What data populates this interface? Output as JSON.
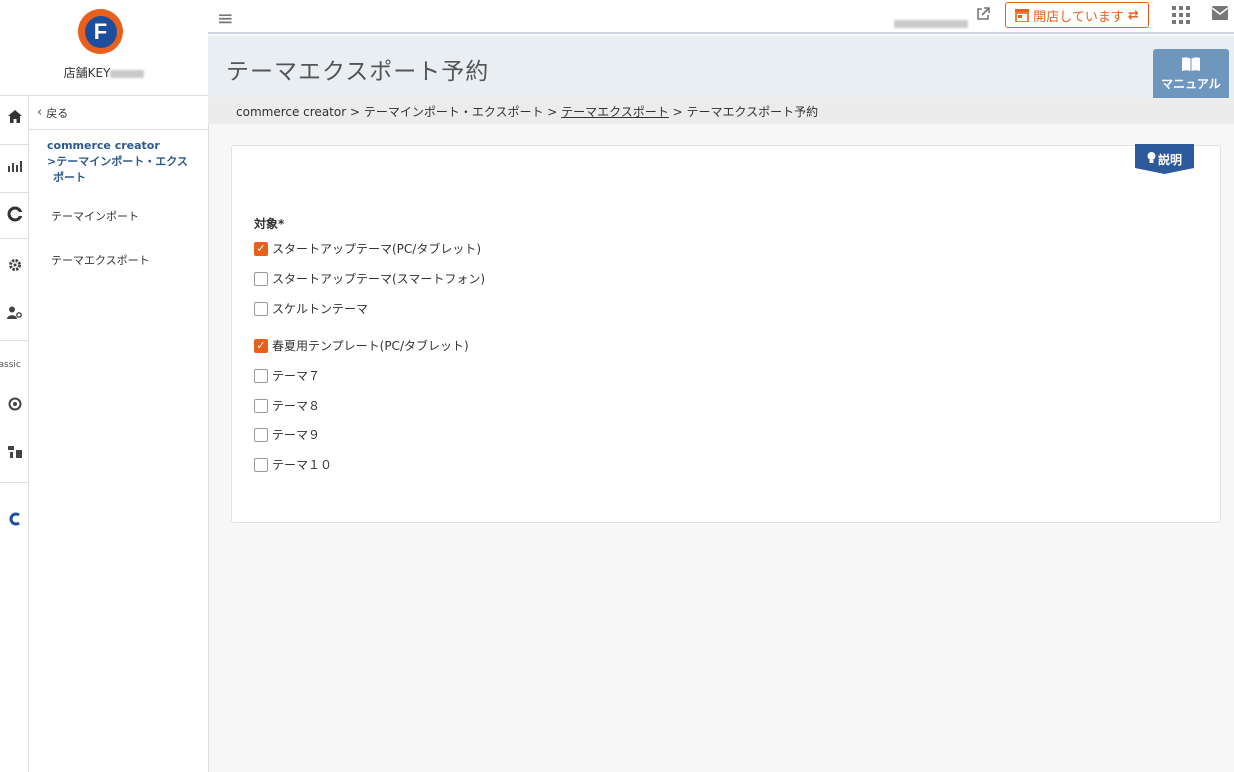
{
  "brand": {
    "logo_letter": "F",
    "shop_name": "店舗KEY"
  },
  "rail": {
    "classic_label": "lassic"
  },
  "subnav": {
    "back_label": "戻る",
    "section_title_line1": "commerce creator",
    "section_title_line2": ">テーマインポート・エクス",
    "section_title_line3": "ポート",
    "items": [
      {
        "label": "テーマインポート"
      },
      {
        "label": "テーマエクスポート"
      }
    ]
  },
  "topbar": {
    "store_status": "開店しています"
  },
  "header": {
    "title": "テーマエクスポート予約",
    "manual_label": "マニュアル"
  },
  "breadcrumb": {
    "part1": "commerce creator > テーマインポート・エクスポート > ",
    "link": "テーマエクスポート",
    "part2": " > テーマエクスポート予約"
  },
  "form": {
    "explain_label": "説明",
    "field_label": "対象*",
    "options": [
      {
        "label": "スタートアップテーマ(PC/タブレット)",
        "checked": true
      },
      {
        "label": "スタートアップテーマ(スマートフォン)",
        "checked": false
      },
      {
        "label": "スケルトンテーマ",
        "checked": false
      },
      {
        "label": "春夏用テンプレート(PC/タブレット)",
        "checked": true
      },
      {
        "label": "テーマ７",
        "checked": false
      },
      {
        "label": "テーマ８",
        "checked": false
      },
      {
        "label": "テーマ９",
        "checked": false
      },
      {
        "label": "テーマ１０",
        "checked": false
      }
    ]
  },
  "colors": {
    "accent": "#e8601c",
    "brand_blue": "#1d4e9e",
    "link_blue": "#2c5a8c"
  }
}
